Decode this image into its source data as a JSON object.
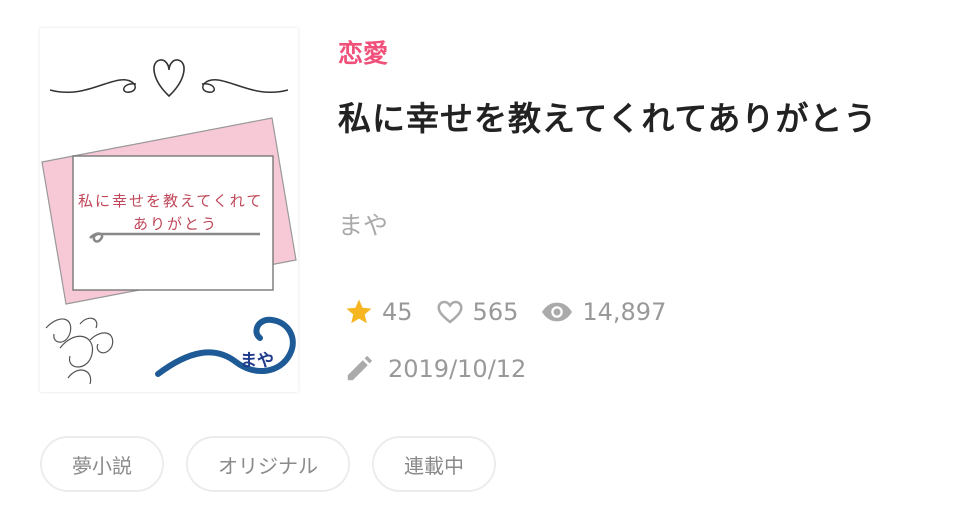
{
  "book": {
    "genre": "恋愛",
    "title": "私に幸せを教えてくれてありがとう",
    "author": "まや",
    "cover": {
      "title_line1": "私に幸せを教えてくれて",
      "title_line2": "ありがとう",
      "author": "まや"
    }
  },
  "stats": {
    "stars": "45",
    "likes": "565",
    "views": "14,897"
  },
  "updated": "2019/10/12",
  "tags": [
    "夢小説",
    "オリジナル",
    "連載中"
  ],
  "colors": {
    "genre": "#f0507a",
    "star": "#f5b621",
    "muted": "#999999"
  }
}
